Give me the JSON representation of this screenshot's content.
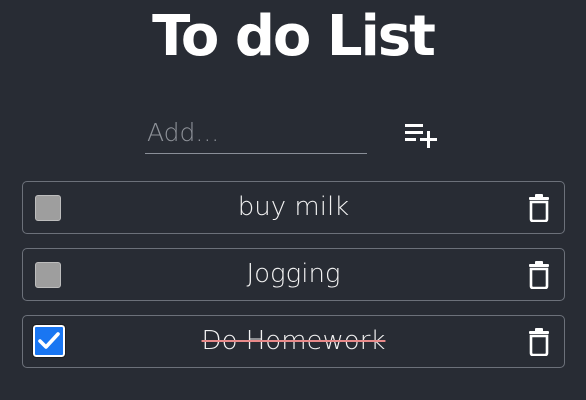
{
  "app": {
    "title": "To do List"
  },
  "add": {
    "placeholder": "Add...",
    "value": "",
    "button_icon": "playlist-add-icon"
  },
  "todos": [
    {
      "text": "buy milk",
      "completed": false
    },
    {
      "text": "Jogging",
      "completed": false
    },
    {
      "text": "Do Homework",
      "completed": true
    }
  ],
  "icons": {
    "delete": "trash-icon",
    "check": "check-icon"
  },
  "colors": {
    "background": "#282c34",
    "checked_accent": "#1976f2",
    "unchecked_box": "#9e9e9e",
    "strikethrough": "#e88a8a",
    "item_border": "#6c717a"
  }
}
